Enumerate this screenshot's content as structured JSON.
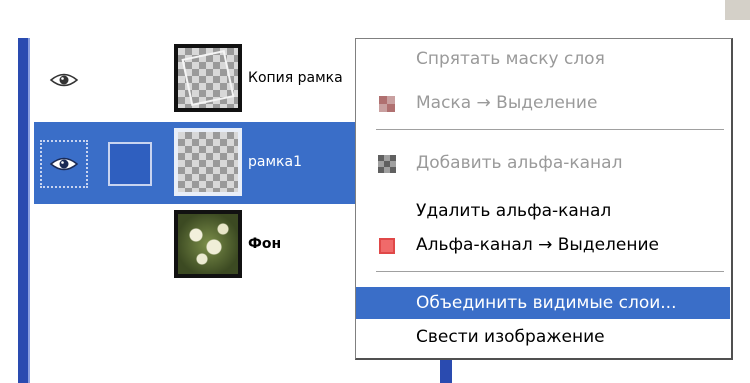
{
  "layers": [
    {
      "name": "Копия рамка",
      "bold": false,
      "selected": false,
      "visible": true,
      "thumbnail": "checker-with-rotated-frame"
    },
    {
      "name": "рамка1",
      "bold": false,
      "selected": true,
      "visible": true,
      "thumbnail": "checker"
    },
    {
      "name": "Фон",
      "bold": true,
      "selected": false,
      "visible": false,
      "thumbnail": "flower-photo"
    }
  ],
  "context_menu": {
    "items": [
      {
        "label": "Спрятать маску слоя",
        "disabled": true,
        "icon": "none"
      },
      {
        "label": "Маска → Выделение",
        "disabled": true,
        "icon": "mask-to-selection-icon"
      },
      {
        "label": "Добавить альфа-канал",
        "disabled": true,
        "icon": "add-alpha-icon"
      },
      {
        "label": "Удалить альфа-канал",
        "disabled": false,
        "icon": "none"
      },
      {
        "label": "Альфа-канал → Выделение",
        "disabled": false,
        "icon": "alpha-to-selection-icon"
      },
      {
        "label": "Объединить видимые слои...",
        "disabled": false,
        "highlighted": true,
        "icon": "none"
      },
      {
        "label": "Свести изображение",
        "disabled": false,
        "icon": "none"
      }
    ]
  },
  "colors": {
    "selection": "#3a6ec8",
    "disabled_text": "#9a9a9a",
    "panel_border": "#2a4bb0"
  }
}
